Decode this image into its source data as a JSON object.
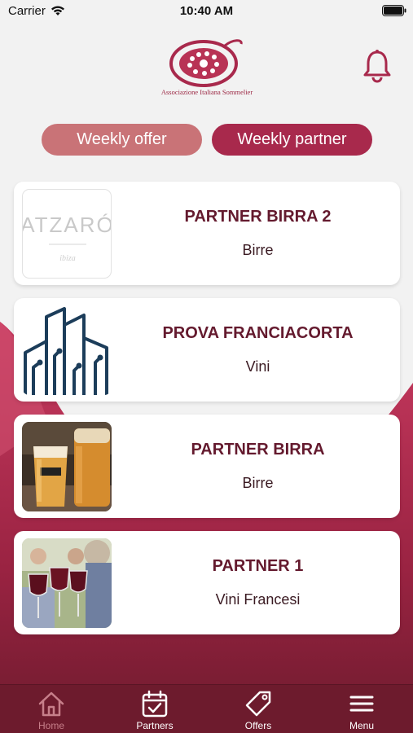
{
  "status_bar": {
    "carrier": "Carrier",
    "time": "10:40 AM"
  },
  "header": {
    "logo_text": "Associazione Italiana Sommelier",
    "bell_icon": "bell-icon"
  },
  "tabs": [
    {
      "label": "Weekly offer",
      "active": false
    },
    {
      "label": "Weekly partner",
      "active": true
    }
  ],
  "partners": [
    {
      "name": "PARTNER BIRRA 2",
      "category": "Birre",
      "image": "atzaro-logo",
      "image_text": "ATZARÓ",
      "image_subtext": "ibiza"
    },
    {
      "name": "PROVA FRANCIACORTA",
      "category": "Vini",
      "image": "city-circuit-logo"
    },
    {
      "name": "PARTNER BIRRA",
      "category": "Birre",
      "image": "beer-glass-photo"
    },
    {
      "name": "PARTNER 1",
      "category": "Vini Francesi",
      "image": "wine-toast-photo"
    }
  ],
  "tabbar": [
    {
      "label": "Home",
      "icon": "home-icon",
      "active": false
    },
    {
      "label": "Partners",
      "icon": "calendar-check-icon",
      "active": true
    },
    {
      "label": "Offers",
      "icon": "tag-icon",
      "active": true
    },
    {
      "label": "Menu",
      "icon": "hamburger-icon",
      "active": true
    }
  ],
  "colors": {
    "brand": "#a8294c",
    "brand_light": "#c97377",
    "dark": "#6d1b2d",
    "title_text": "#641a2e"
  }
}
